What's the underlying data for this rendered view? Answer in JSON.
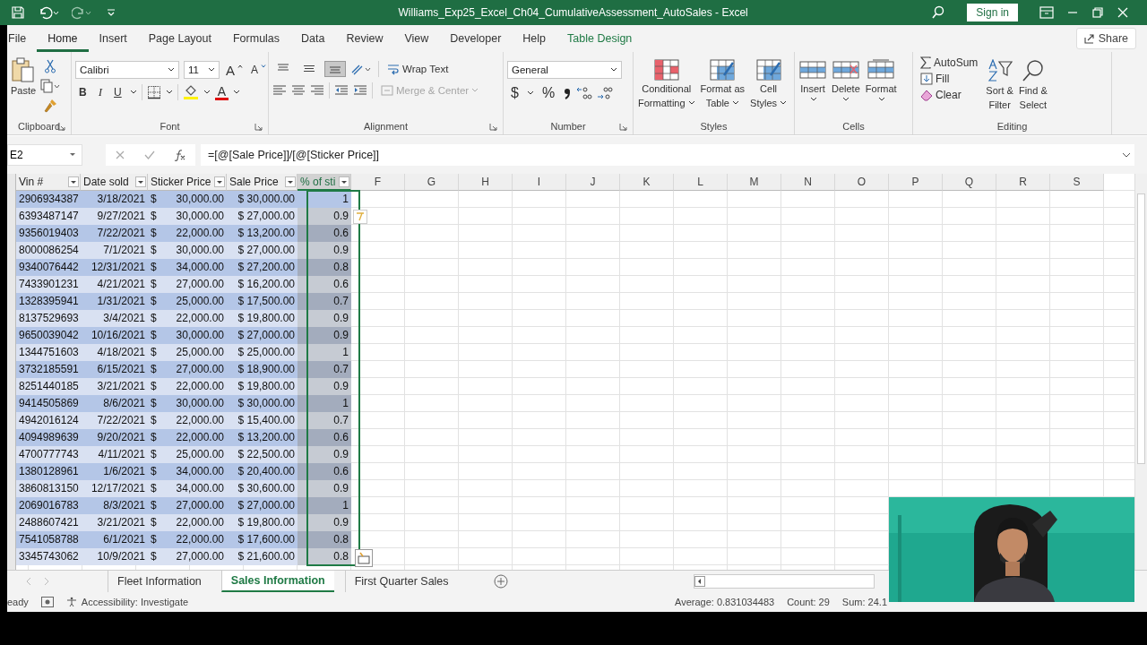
{
  "title_bar": {
    "title": "Williams_Exp25_Excel_Ch04_CumulativeAssessment_AutoSales - Excel",
    "sign_in": "Sign in"
  },
  "menu_tabs": [
    {
      "label": "File",
      "kind": "standard",
      "selected": false
    },
    {
      "label": "Home",
      "kind": "standard",
      "selected": true
    },
    {
      "label": "Insert",
      "kind": "standard",
      "selected": false
    },
    {
      "label": "Page Layout",
      "kind": "standard",
      "selected": false
    },
    {
      "label": "Formulas",
      "kind": "standard",
      "selected": false
    },
    {
      "label": "Data",
      "kind": "standard",
      "selected": false
    },
    {
      "label": "Review",
      "kind": "standard",
      "selected": false
    },
    {
      "label": "View",
      "kind": "standard",
      "selected": false
    },
    {
      "label": "Developer",
      "kind": "standard",
      "selected": false
    },
    {
      "label": "Help",
      "kind": "standard",
      "selected": false
    },
    {
      "label": "Table Design",
      "kind": "contextual",
      "selected": false
    }
  ],
  "share": "Share",
  "ribbon": {
    "clipboard": {
      "label": "Clipboard",
      "paste": "Paste"
    },
    "font": {
      "label": "Font",
      "font_name": "Calibri",
      "font_size": "11",
      "grow": "A",
      "shrink": "A",
      "bold": "B",
      "italic": "I",
      "underline": "U",
      "font_color": "A"
    },
    "alignment": {
      "label": "Alignment",
      "vertical_align": [
        {
          "selected": false
        },
        {
          "selected": false
        },
        {
          "selected": true
        }
      ],
      "wrap_text": "Wrap Text",
      "merge_center": "Merge & Center",
      "merge_disabled": true
    },
    "number": {
      "label": "Number",
      "format": "General",
      "currency": "$",
      "percent": "%"
    },
    "styles": {
      "label": "Styles",
      "buttons": [
        {
          "lines": [
            "Conditional",
            "Formatting"
          ]
        },
        {
          "lines": [
            "Format as",
            "Table"
          ]
        },
        {
          "lines": [
            "Cell",
            "Styles"
          ]
        }
      ]
    },
    "cells": {
      "label": "Cells",
      "buttons": [
        "Insert",
        "Delete",
        "Format"
      ]
    },
    "editing": {
      "label": "Editing",
      "autosum": "AutoSum",
      "fill": "Fill",
      "clear": "Clear",
      "sort": [
        "Sort &",
        "Filter"
      ],
      "find": [
        "Find &",
        "Select"
      ]
    }
  },
  "formula_bar": {
    "name_box": "E2",
    "formula": "=[@[Sale Price]]/[@[Sticker Price]]"
  },
  "table": {
    "columns": [
      {
        "label": "Vin #",
        "selected": false
      },
      {
        "label": "Date sold",
        "selected": false
      },
      {
        "label": "Sticker Price",
        "selected": false
      },
      {
        "label": "Sale Price",
        "selected": false
      },
      {
        "label": "% of sti",
        "selected": true
      }
    ],
    "column_letters": [
      "F",
      "G",
      "H",
      "I",
      "J",
      "K",
      "L",
      "M",
      "N",
      "O",
      "P",
      "Q",
      "R",
      "S"
    ],
    "rows": [
      {
        "vin": "2906934387",
        "date": "3/18/2021",
        "currency": "$",
        "sticker": "30,000.00",
        "sale": "$ 30,000.00",
        "pct": "1",
        "active": true
      },
      {
        "vin": "6393487147",
        "date": "9/27/2021",
        "currency": "$",
        "sticker": "30,000.00",
        "sale": "$ 27,000.00",
        "pct": "0.9",
        "active": false
      },
      {
        "vin": "9356019403",
        "date": "7/22/2021",
        "currency": "$",
        "sticker": "22,000.00",
        "sale": "$ 13,200.00",
        "pct": "0.6",
        "active": false
      },
      {
        "vin": "8000086254",
        "date": "7/1/2021",
        "currency": "$",
        "sticker": "30,000.00",
        "sale": "$ 27,000.00",
        "pct": "0.9",
        "active": false
      },
      {
        "vin": "9340076442",
        "date": "12/31/2021",
        "currency": "$",
        "sticker": "34,000.00",
        "sale": "$ 27,200.00",
        "pct": "0.8",
        "active": false
      },
      {
        "vin": "7433901231",
        "date": "4/21/2021",
        "currency": "$",
        "sticker": "27,000.00",
        "sale": "$ 16,200.00",
        "pct": "0.6",
        "active": false
      },
      {
        "vin": "1328395941",
        "date": "1/31/2021",
        "currency": "$",
        "sticker": "25,000.00",
        "sale": "$ 17,500.00",
        "pct": "0.7",
        "active": false
      },
      {
        "vin": "8137529693",
        "date": "3/4/2021",
        "currency": "$",
        "sticker": "22,000.00",
        "sale": "$ 19,800.00",
        "pct": "0.9",
        "active": false
      },
      {
        "vin": "9650039042",
        "date": "10/16/2021",
        "currency": "$",
        "sticker": "30,000.00",
        "sale": "$ 27,000.00",
        "pct": "0.9",
        "active": false
      },
      {
        "vin": "1344751603",
        "date": "4/18/2021",
        "currency": "$",
        "sticker": "25,000.00",
        "sale": "$ 25,000.00",
        "pct": "1",
        "active": false
      },
      {
        "vin": "3732185591",
        "date": "6/15/2021",
        "currency": "$",
        "sticker": "27,000.00",
        "sale": "$ 18,900.00",
        "pct": "0.7",
        "active": false
      },
      {
        "vin": "8251440185",
        "date": "3/21/2021",
        "currency": "$",
        "sticker": "22,000.00",
        "sale": "$ 19,800.00",
        "pct": "0.9",
        "active": false
      },
      {
        "vin": "9414505869",
        "date": "8/6/2021",
        "currency": "$",
        "sticker": "30,000.00",
        "sale": "$ 30,000.00",
        "pct": "1",
        "active": false
      },
      {
        "vin": "4942016124",
        "date": "7/22/2021",
        "currency": "$",
        "sticker": "22,000.00",
        "sale": "$ 15,400.00",
        "pct": "0.7",
        "active": false
      },
      {
        "vin": "4094989639",
        "date": "9/20/2021",
        "currency": "$",
        "sticker": "22,000.00",
        "sale": "$ 13,200.00",
        "pct": "0.6",
        "active": false
      },
      {
        "vin": "4700777743",
        "date": "4/11/2021",
        "currency": "$",
        "sticker": "25,000.00",
        "sale": "$ 22,500.00",
        "pct": "0.9",
        "active": false
      },
      {
        "vin": "1380128961",
        "date": "1/6/2021",
        "currency": "$",
        "sticker": "34,000.00",
        "sale": "$ 20,400.00",
        "pct": "0.6",
        "active": false
      },
      {
        "vin": "3860813150",
        "date": "12/17/2021",
        "currency": "$",
        "sticker": "34,000.00",
        "sale": "$ 30,600.00",
        "pct": "0.9",
        "active": false
      },
      {
        "vin": "2069016783",
        "date": "8/3/2021",
        "currency": "$",
        "sticker": "27,000.00",
        "sale": "$ 27,000.00",
        "pct": "1",
        "active": false
      },
      {
        "vin": "2488607421",
        "date": "3/21/2021",
        "currency": "$",
        "sticker": "22,000.00",
        "sale": "$ 19,800.00",
        "pct": "0.9",
        "active": false
      },
      {
        "vin": "7541058788",
        "date": "6/1/2021",
        "currency": "$",
        "sticker": "22,000.00",
        "sale": "$ 17,600.00",
        "pct": "0.8",
        "active": false
      },
      {
        "vin": "3345743062",
        "date": "10/9/2021",
        "currency": "$",
        "sticker": "27,000.00",
        "sale": "$ 21,600.00",
        "pct": "0.8",
        "active": false
      }
    ]
  },
  "sheet_tabs": [
    {
      "label": "Fleet Information",
      "selected": false
    },
    {
      "label": "Sales Information",
      "selected": true
    },
    {
      "label": "First Quarter Sales",
      "selected": false
    }
  ],
  "status_bar": {
    "mode": "eady",
    "accessibility": "Accessibility: Investigate",
    "average": "Average: 0.831034483",
    "count": "Count: 29",
    "sum": "Sum: 24.1"
  }
}
